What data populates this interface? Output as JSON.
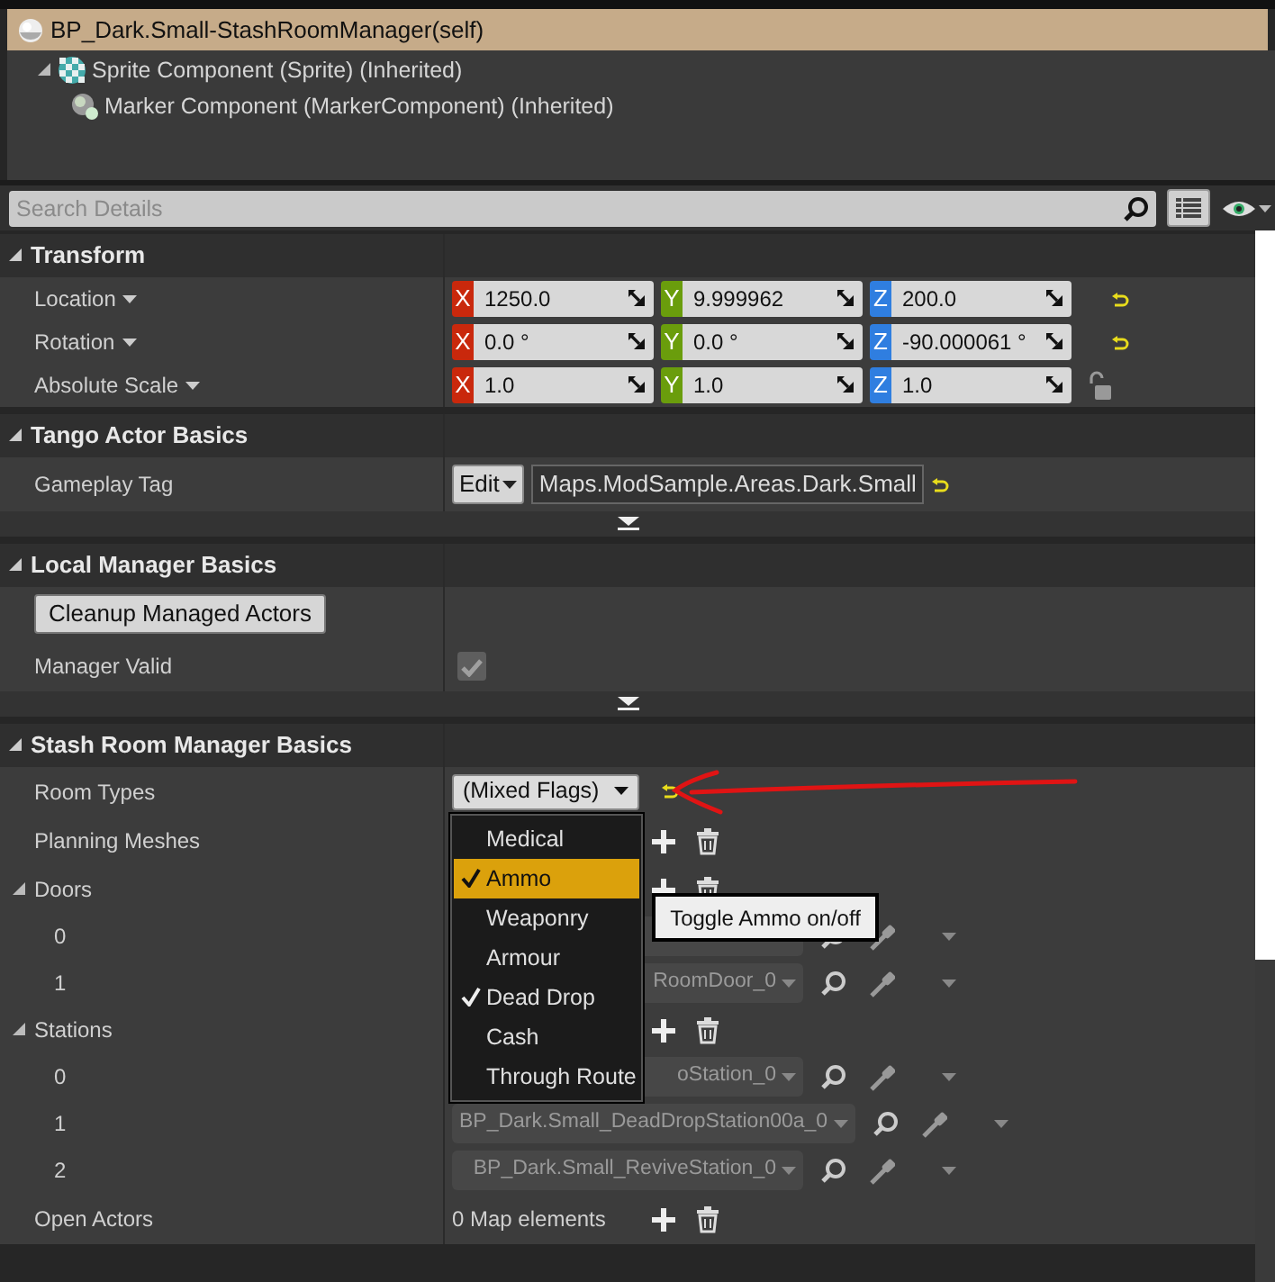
{
  "title": "BP_Dark.Small-StashRoomManager(self)",
  "components": [
    {
      "label": "Sprite Component (Sprite) (Inherited)",
      "expanded": true,
      "children": [
        {
          "label": "Marker Component (MarkerComponent) (Inherited)"
        }
      ]
    }
  ],
  "search": {
    "placeholder": "Search Details"
  },
  "sections": [
    {
      "title": "Transform",
      "expanded": true,
      "rows": [
        {
          "kind": "vector",
          "label": "Location",
          "has_menu": true,
          "resettable": true,
          "fields": [
            {
              "axis": "X",
              "value": "1250.0"
            },
            {
              "axis": "Y",
              "value": "9.999962"
            },
            {
              "axis": "Z",
              "value": "200.0"
            }
          ]
        },
        {
          "kind": "vector",
          "label": "Rotation",
          "has_menu": true,
          "resettable": true,
          "fields": [
            {
              "axis": "X",
              "value": "0.0 °"
            },
            {
              "axis": "Y",
              "value": "0.0 °"
            },
            {
              "axis": "Z",
              "value": "-90.000061 °"
            }
          ]
        },
        {
          "kind": "vector",
          "label": "Absolute Scale",
          "has_menu": true,
          "lockable": true,
          "fields": [
            {
              "axis": "X",
              "value": "1.0"
            },
            {
              "axis": "Y",
              "value": "1.0"
            },
            {
              "axis": "Z",
              "value": "1.0"
            }
          ]
        }
      ]
    },
    {
      "title": "Tango Actor Basics",
      "expanded": true,
      "advanced": true,
      "rows": [
        {
          "kind": "tag",
          "label": "Gameplay Tag",
          "button": "Edit",
          "value": "Maps.ModSample.Areas.Dark.Small",
          "resettable": true
        }
      ]
    },
    {
      "title": "Local Manager Basics",
      "expanded": true,
      "advanced": true,
      "rows": [
        {
          "kind": "button",
          "text": "Cleanup Managed Actors"
        },
        {
          "kind": "checkbox",
          "label": "Manager Valid",
          "checked": true,
          "disabled": true
        }
      ]
    },
    {
      "title": "Stash Room Manager Basics",
      "expanded": true,
      "rows": [
        {
          "kind": "flags",
          "label": "Room Types",
          "value": "(Mixed Flags)",
          "resettable": true,
          "menu": {
            "tooltip": "Toggle Ammo on/off",
            "items": [
              {
                "label": "Medical",
                "checked": false,
                "selected": false
              },
              {
                "label": "Ammo",
                "checked": true,
                "selected": true
              },
              {
                "label": "Weaponry",
                "checked": false,
                "selected": false
              },
              {
                "label": "Armour",
                "checked": false,
                "selected": false
              },
              {
                "label": "Dead Drop",
                "checked": true,
                "selected": false
              },
              {
                "label": "Cash",
                "checked": false,
                "selected": false
              },
              {
                "label": "Through Route",
                "checked": false,
                "selected": false
              }
            ]
          }
        },
        {
          "kind": "array",
          "label": "Planning Meshes"
        },
        {
          "kind": "array",
          "label": "Doors",
          "expanded": true,
          "children": [
            {
              "label": "0"
            },
            {
              "label": "1",
              "value": "RoomDoor_0"
            }
          ]
        },
        {
          "kind": "array",
          "label": "Stations",
          "expanded": true,
          "children": [
            {
              "label": "0",
              "value": "oStation_0"
            },
            {
              "label": "1",
              "value": "BP_Dark.Small_DeadDropStation00a_0"
            },
            {
              "label": "2",
              "value": "BP_Dark.Small_ReviveStation_0"
            }
          ]
        },
        {
          "kind": "array",
          "label": "Open Actors",
          "count": "0 Map elements"
        }
      ]
    }
  ]
}
